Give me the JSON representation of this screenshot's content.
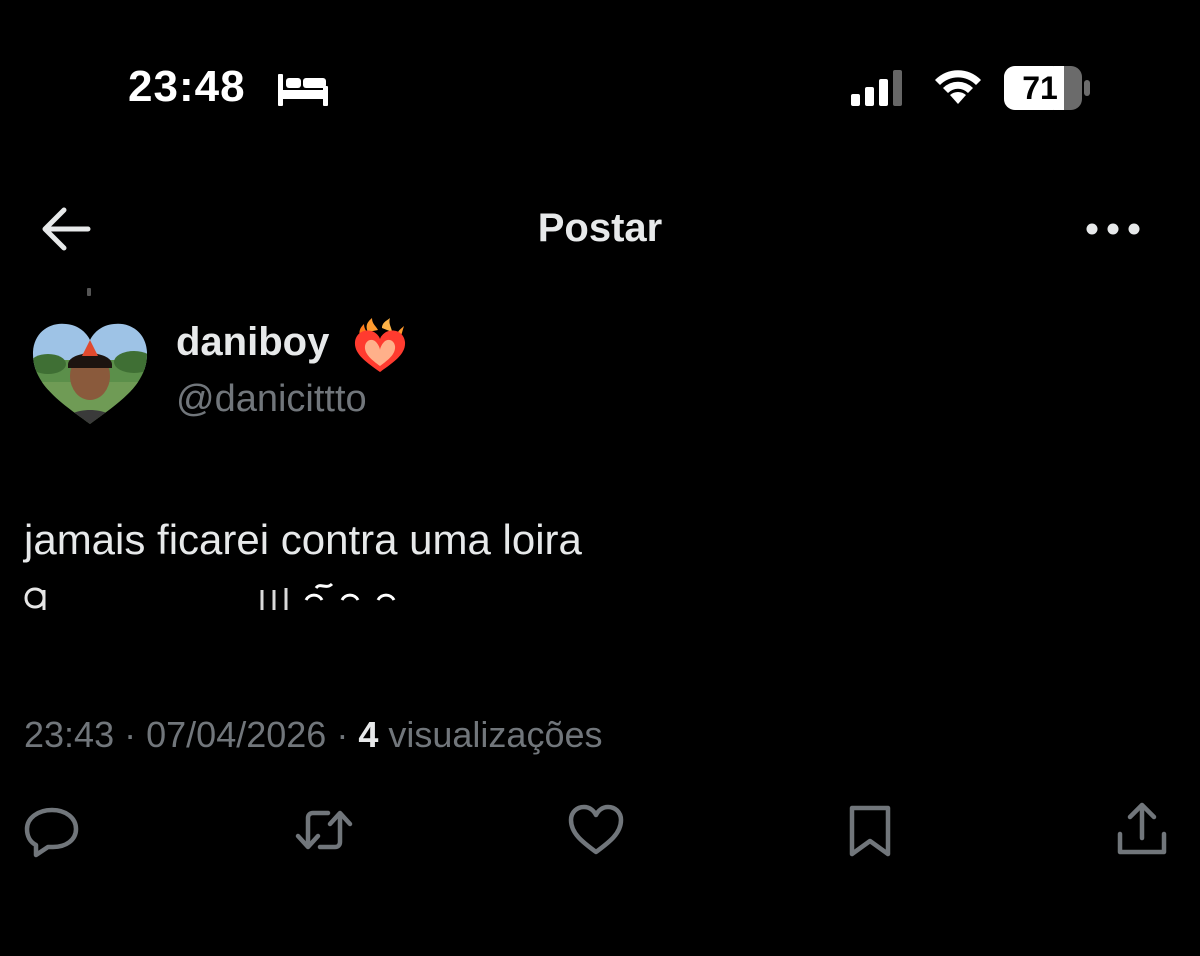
{
  "status_bar": {
    "time": "23:48",
    "battery_level": "71",
    "icons": [
      "sleep-mode-icon",
      "cellular-signal-icon",
      "wifi-icon",
      "battery-icon"
    ]
  },
  "header": {
    "title": "Postar",
    "icons": [
      "back-arrow-icon",
      "more-options-icon"
    ]
  },
  "author": {
    "display_name": "daniboy",
    "username": "@danicittto",
    "badge_icon": "heart-on-fire-emoji"
  },
  "post": {
    "text_visible": "jamais ficarei contra uma loira",
    "timestamp": "23:43",
    "separator": "·",
    "date": "07/04/2026",
    "views_count": "4",
    "views_label": "visualizações"
  },
  "actions": [
    {
      "name": "reply",
      "icon": "reply-icon"
    },
    {
      "name": "repost",
      "icon": "repost-icon"
    },
    {
      "name": "like",
      "icon": "heart-icon"
    },
    {
      "name": "bookmark",
      "icon": "bookmark-icon"
    },
    {
      "name": "share",
      "icon": "share-icon"
    }
  ],
  "colors": {
    "background": "#000000",
    "primary_text": "#e7e9ea",
    "secondary_text": "#71767b",
    "icon": "#71767b"
  }
}
